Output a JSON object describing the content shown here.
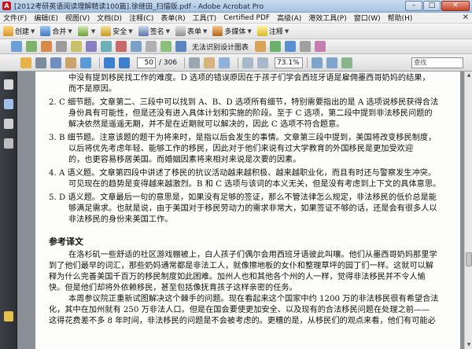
{
  "window": {
    "title": "[2012考研英语阅读理解精读100篇].徐继田_扫描版.pdf - Adobe Acrobat Pro",
    "minimize": "–",
    "maximize": "□",
    "close": "✕"
  },
  "menu": [
    "文件(F)",
    "编辑(E)",
    "视图(V)",
    "文档(D)",
    "注释(C)",
    "表单(R)",
    "工具(T)",
    "Certified PDF",
    "高级(A)",
    "港效工具(P)",
    "窗口(W)",
    "帮助(H)"
  ],
  "menu_close": "✕",
  "toolbar1": [
    "创建",
    "合并",
    "",
    "安全",
    "签名",
    "表单",
    "多媒体",
    "注释"
  ],
  "toolbar2": {
    "label": "无法识别设计图表"
  },
  "toolbar3": {
    "page_current": "50",
    "page_total": "/ 306",
    "zoom": "73.1%",
    "find_placeholder": "查找"
  },
  "colors": {
    "titlebar": "#b7cde6",
    "sidebar": "#35393e",
    "page": "#fdfdfb"
  },
  "icons": {
    "toolbar1": [
      "create-icon",
      "combine-icon",
      "collaborate-icon",
      "secure-icon",
      "sign-icon",
      "forms-icon",
      "multimedia-icon",
      "comment-icon"
    ],
    "sidebar": [
      "pages-icon",
      "bookmarks-icon",
      "signatures-icon",
      "attachments-icon",
      "comments-icon"
    ]
  },
  "document": {
    "lines": [
      {
        "text": "中没有提到移民找工作的难度。D 选项的错误原因在于孩子们学会西班牙语是雇佣墨西哥奶妈的结果，",
        "cls": "indent"
      },
      {
        "text": "而不是原因。",
        "cls": "indent"
      },
      {
        "text": "2. C  细节题。文章第二、三段中可以找到 A、B、D 选项所有细节，特别需要指出的是 A 选项说移民获得合法",
        "cls": "ans"
      },
      {
        "text": "身份具有可能性，但是还没有进入具体计划和实施的阶段。至于 C 选项，第二段中提到非法移民问题的",
        "cls": "indent"
      },
      {
        "text": "解决依然是遥遥无期，并不是在近期就可以解决的，因此 C 选项不符合题意。",
        "cls": "indent"
      },
      {
        "text": "3. B  细节题。注意该题的题干为将来时，是指以后会发生的事情。文章第三段中提到，美国将改变移民制度，",
        "cls": "ans"
      },
      {
        "text": "以后将优先考虑年轻、能够工作的移民，因此对于他们来说有过大学教育的外国移民是更加受欢迎",
        "cls": "indent"
      },
      {
        "text": "的，也更容易移居美国。而婚姻因素将来相对来说是次要的因素。",
        "cls": "indent"
      },
      {
        "text": "4. A  语义题。文章第四段中讲述了移民的抗议活动越来越积极、越来越职业化，而且有时还与警察发生冲突。",
        "cls": "ans"
      },
      {
        "text": "可见现在的趋势是变得越来越激烈。B 和 C 选项与该词的本义无关，但是没有考虑到上下文的具体意思。",
        "cls": "indent"
      },
      {
        "text": "5. D  语义题。文章最后一句的意思是，如果没有足够的签证，那么不管法律怎么规定，非法移民的低价总是能",
        "cls": "ans"
      },
      {
        "text": "够满足需求。也就是说，由于美国对于移民劳动力的需求非常大，如果签证不够的话，还是会有很多人以",
        "cls": "indent"
      },
      {
        "text": "非法移民的身份来美国工作。",
        "cls": "indent"
      }
    ],
    "ref_title": "参考译文",
    "trans_lines": [
      {
        "text": "在洛杉矶一些舒适的社区游戏棚被上，白人孩子们偶尔会用西班牙语彼此叫嚷。他们从墨西哥奶妈那里学",
        "cls": "indent"
      },
      {
        "text": "到了他们最早的词汇，那些奶妈通常都是非法工人，就像擦地板的女仆和整理草坪的园丁们一样。这就可以解",
        "cls": ""
      },
      {
        "text": "释为什么完善美国千百万的移民制度如此困难。加州人也和其他各个州的人一样，觉得非法移民并不令人愉",
        "cls": ""
      },
      {
        "text": "快。但是他们却将外依赖移民，甚至包括像抚育孩子这样亲密的任务。",
        "cls": ""
      },
      {
        "text": "本周参议院正重新试图解决这个棘手的问题。现在看起来这个国家中约 1200 万的非法移民很有希望合法",
        "cls": "indent"
      },
      {
        "text": "化，其中在加州就有 250 万非法人口。但是在国会要使更加安全、以及现有的合法移民问题在处理之前——",
        "cls": ""
      },
      {
        "text": "这得花费差不多 8 年时间，非法移民的问题是不会被考虑的。更糟的是，从移民们的观点来看，他们有可能必",
        "cls": ""
      }
    ]
  }
}
